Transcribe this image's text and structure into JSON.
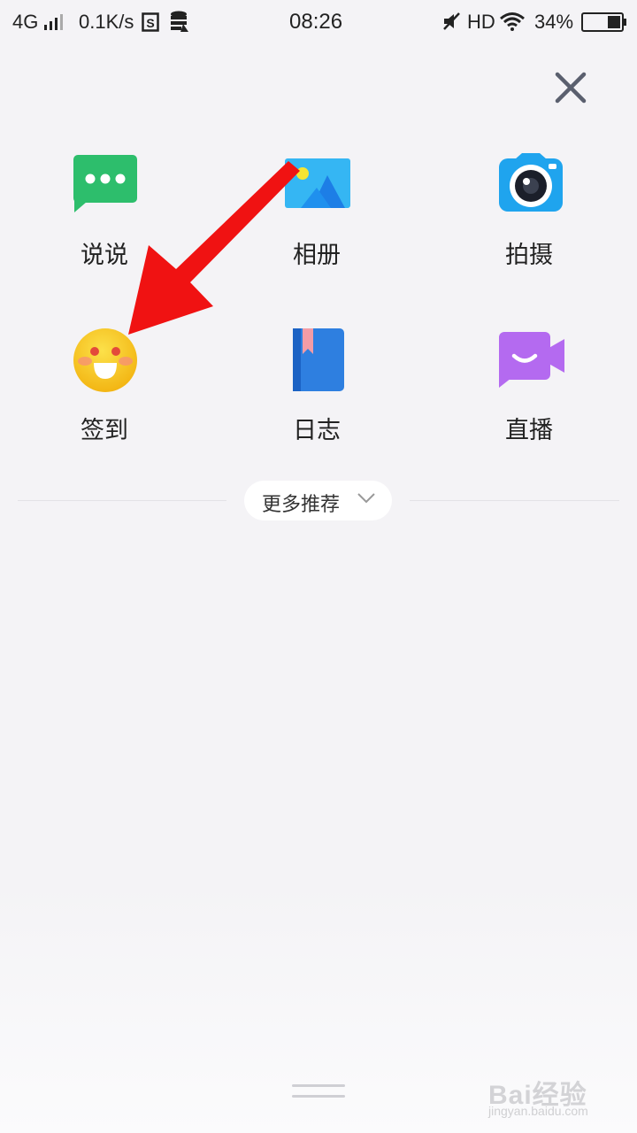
{
  "status_bar": {
    "network": "4G",
    "speed": "0.1K/s",
    "time": "08:26",
    "hd": "HD",
    "battery": "34%",
    "battery_level": 0.34
  },
  "menu": {
    "items": [
      {
        "label": "说说",
        "icon": "message-bubble-icon"
      },
      {
        "label": "相册",
        "icon": "photo-album-icon"
      },
      {
        "label": "拍摄",
        "icon": "camera-icon"
      },
      {
        "label": "签到",
        "icon": "smiley-face-icon"
      },
      {
        "label": "日志",
        "icon": "journal-book-icon"
      },
      {
        "label": "直播",
        "icon": "live-video-icon"
      }
    ],
    "more_label": "更多推荐"
  },
  "watermark": {
    "text": "Bai经验",
    "sub": "jingyan.baidu.com"
  },
  "colors": {
    "annotation_arrow": "#f01212",
    "green": "#2dbe6c",
    "blue": "#1fa4ee",
    "yellow": "#f7c21a",
    "purple": "#b46af0"
  }
}
